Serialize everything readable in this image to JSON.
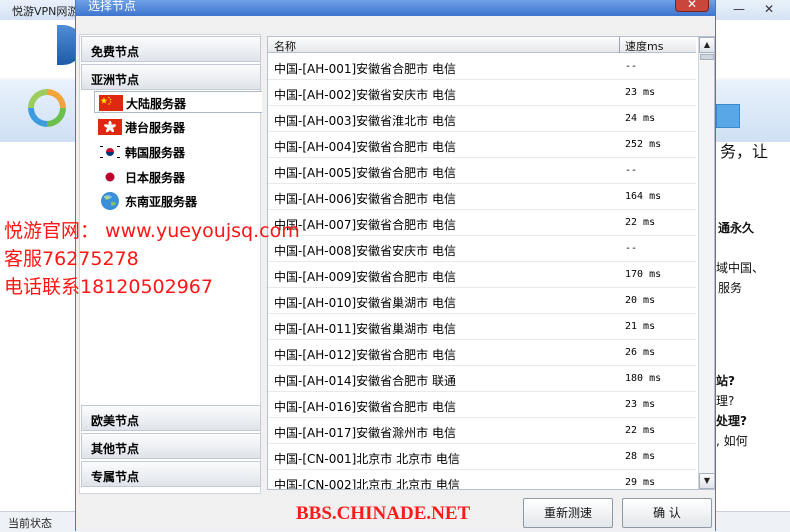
{
  "background_window": {
    "title": "悦游VPN网游",
    "min_icon": "—",
    "close_icon": "✕",
    "side_texts": [
      "务，让",
      "通永久",
      "域中国、",
      "服务",
      "站?",
      "理?",
      "处理?",
      ", 如何"
    ],
    "status": "当前状态"
  },
  "dialog": {
    "title": "选择节点",
    "close_icon": "✕",
    "categories": {
      "free": "免费节点",
      "asia": "亚洲节点",
      "europe_america": "欧美节点",
      "other": "其他节点",
      "dedicated": "专属节点"
    },
    "asia_items": [
      {
        "label": "大陆服务器",
        "icon": "china-flag-icon",
        "selected": true
      },
      {
        "label": "港台服务器",
        "icon": "hongkong-flag-icon",
        "selected": false
      },
      {
        "label": "韩国服务器",
        "icon": "korea-flag-icon",
        "selected": false
      },
      {
        "label": "日本服务器",
        "icon": "japan-flag-icon",
        "selected": false
      },
      {
        "label": "东南亚服务器",
        "icon": "globe-icon",
        "selected": false
      }
    ],
    "list": {
      "col_name": "名称",
      "col_speed": "速度ms",
      "rows": [
        {
          "name": "中国-[AH-001]安徽省合肥市 电信",
          "speed": "--"
        },
        {
          "name": "中国-[AH-002]安徽省安庆市 电信",
          "speed": "23 ms"
        },
        {
          "name": "中国-[AH-003]安徽省淮北市 电信",
          "speed": "24 ms"
        },
        {
          "name": "中国-[AH-004]安徽省合肥市 电信",
          "speed": "252 ms"
        },
        {
          "name": "中国-[AH-005]安徽省合肥市 电信",
          "speed": "--"
        },
        {
          "name": "中国-[AH-006]安徽省合肥市 电信",
          "speed": "164 ms"
        },
        {
          "name": "中国-[AH-007]安徽省合肥市 电信",
          "speed": "22 ms"
        },
        {
          "name": "中国-[AH-008]安徽省安庆市 电信",
          "speed": "--"
        },
        {
          "name": "中国-[AH-009]安徽省合肥市 电信",
          "speed": "170 ms"
        },
        {
          "name": "中国-[AH-010]安徽省巢湖市 电信",
          "speed": "20 ms"
        },
        {
          "name": "中国-[AH-011]安徽省巢湖市 电信",
          "speed": "21 ms"
        },
        {
          "name": "中国-[AH-012]安徽省合肥市 电信",
          "speed": "26 ms"
        },
        {
          "name": "中国-[AH-014]安徽省合肥市 联通",
          "speed": "180 ms"
        },
        {
          "name": "中国-[AH-016]安徽省合肥市 电信",
          "speed": "23 ms"
        },
        {
          "name": "中国-[AH-017]安徽省滁州市 电信",
          "speed": "22 ms"
        },
        {
          "name": "中国-[CN-001]北京市 北京市 电信",
          "speed": "28 ms"
        },
        {
          "name": "中国-[CN-002]北京市 北京市 电信",
          "speed": "29 ms"
        }
      ]
    },
    "buttons": {
      "retest": "重新测速",
      "confirm": "确 认"
    }
  },
  "overlay": {
    "line1": "悦游官网： www.yueyoujsq.com",
    "line2": "客服76275278",
    "line3": "电话联系18120502967",
    "watermark": "BBS.CHINADE.NET"
  },
  "colors": {
    "watermark_red": "#ff1616",
    "title_blue": "#3e74cf",
    "close_red": "#c9463d"
  }
}
